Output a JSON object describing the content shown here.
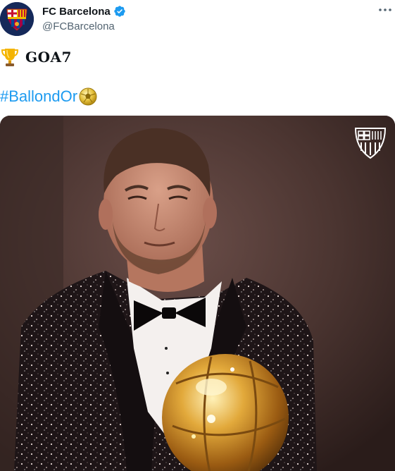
{
  "author": {
    "display_name": "FC Barcelona",
    "handle": "@FCBarcelona",
    "verified": true
  },
  "tweet": {
    "line1_emoji": "trophy-icon",
    "line1_text": "GOA7",
    "hashtag": "#BallondOr",
    "hashtag_emoji": "soccer-ball-icon"
  },
  "media": {
    "description_type": "video-still",
    "overlay_logo": "fcb-crest"
  },
  "colors": {
    "link": "#1d9bf0",
    "handle": "#536471",
    "text": "#0f1419",
    "verified": "#1d9bf0"
  }
}
